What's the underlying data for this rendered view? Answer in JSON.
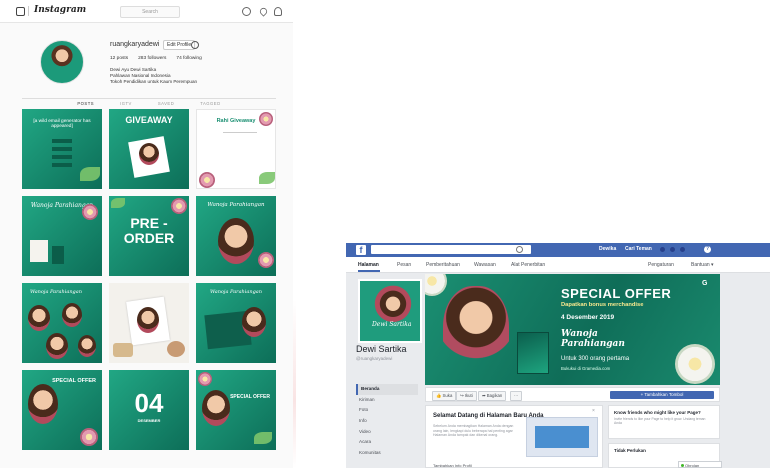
{
  "instagram": {
    "logo_text": "Instagram",
    "search_placeholder": "Search",
    "username": "ruangkaryadewi",
    "edit_label": "Edit Profile",
    "stats": [
      "12 posts",
      "283 followers",
      "74 following"
    ],
    "bio": [
      "Dewi Ayu Dewi Sartika",
      "Pahlawan Nasional Indonesia",
      "Tokoh Pendidikan untuk Kaum Perempuan"
    ],
    "tabs": [
      "POSTS",
      "IGTV",
      "SAVED",
      "TAGGED"
    ],
    "tiles": [
      {
        "title": "[a wild email generator has appeared]",
        "style": "green-text"
      },
      {
        "title": "GIVEAWAY",
        "style": "green-giveaway"
      },
      {
        "title": "Rahi Giveaway",
        "style": "white-list"
      },
      {
        "title": "Wanoja Parahiangan",
        "style": "green-script"
      },
      {
        "title": "PRE - ORDER",
        "style": "green-preorder"
      },
      {
        "title": "Wanoja Parahiangan",
        "style": "green-face"
      },
      {
        "title": "Wanoja Parahiangan",
        "style": "green-collage"
      },
      {
        "title": "",
        "style": "light-photo"
      },
      {
        "title": "Wanoja Parahiangan",
        "style": "green-book"
      },
      {
        "title": "SPECIAL OFFER",
        "style": "green-offer"
      },
      {
        "title": "04",
        "style": "green-number"
      },
      {
        "title": "SPECIAL OFFER",
        "style": "green-offer2"
      }
    ],
    "tile_number_sub": "DESEMBER"
  },
  "facebook": {
    "logo": "f",
    "nav_name": "Dewika",
    "nav_find": "Cari Teman",
    "help": "?",
    "menu": [
      "Halaman",
      "Pesan",
      "Pemberitahuan",
      "Wawasan",
      "Alat Penerbitan"
    ],
    "menu_right": [
      "Pengaturan",
      "Bantuan ▾"
    ],
    "page_name": "Dewi Sartika",
    "page_handle": "@ruangkaryadewi",
    "profile_signature": "Dewi Sartika",
    "sidebar": [
      "Beranda",
      "Kiriman",
      "Foto",
      "Info",
      "Video",
      "Acara",
      "Komunitas"
    ],
    "cover": {
      "title": "SPECIAL OFFER",
      "subtitle": "Dapatkan bonus merchandise",
      "date": "4 Desember 2019",
      "script_line1": "Wanoja",
      "script_line2": "Parahiangan",
      "tagline": "Untuk 300 orang pertama",
      "site": "Bukukui di Gramedia.com",
      "brand": "G"
    },
    "actions": [
      "👍 Suka",
      "↪ Ikuti",
      "➦ Bagikan",
      "···"
    ],
    "cta": "+ Tambahkan Tombol",
    "welcome_title": "Selamat Datang di Halaman Baru Anda",
    "welcome_text": "Sebelum Anda membagikan Halaman Anda dengan orang lain, lengkapi dulu beberapa hal penting agar Halaman Anda tampak dan dikenal orang.",
    "welcome_close": "×",
    "add_info": "Tambahkan Info Profil",
    "card1_title": "Know friends who might like your Page?",
    "card1_text": "Invite friends to like your Page to help it grow. Undang teman Anda",
    "card2_title": "Tidak Perlukan",
    "chat_label": "Obrolan"
  }
}
